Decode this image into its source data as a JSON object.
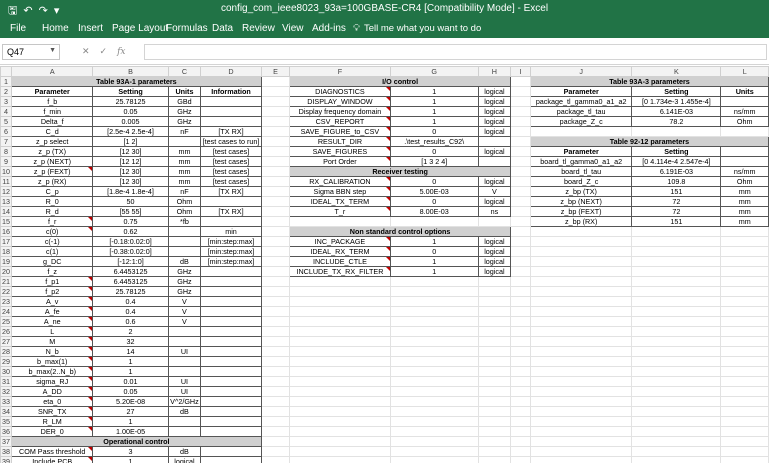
{
  "window": {
    "title": "config_com_ieee8023_93a=100GBASE-CR4  [Compatibility Mode] - Excel",
    "qat_icons": [
      "save-icon",
      "undo-icon",
      "redo-icon",
      "customize-icon"
    ]
  },
  "ribbon": {
    "tabs": [
      "File",
      "Home",
      "Insert",
      "Page Layout",
      "Formulas",
      "Data",
      "Review",
      "View",
      "Add-ins"
    ],
    "tell_me": "Tell me what you want to do"
  },
  "formula_bar": {
    "name_box": "Q47",
    "fx_label": "fx",
    "value": ""
  },
  "accent_color": "#217346",
  "columns": [
    "A",
    "B",
    "C",
    "D",
    "E",
    "F",
    "G",
    "H",
    "I",
    "J",
    "K",
    "L"
  ],
  "rows": [
    [
      "Table 93A-1 parameters",
      "",
      "",
      "",
      "",
      "I/O control",
      "",
      "",
      "",
      "Table 93A-3 parameters",
      "",
      ""
    ],
    [
      "Parameter",
      "Setting",
      "Units",
      "Information",
      "",
      "DIAGNOSTICS",
      "1",
      "logical",
      "",
      "Parameter",
      "Setting",
      "Units"
    ],
    [
      "f_b",
      "25.78125",
      "GBd",
      "",
      "",
      "DISPLAY_WINDOW",
      "1",
      "logical",
      "",
      "package_tl_gamma0_a1_a2",
      "[0 1.734e-3 1.455e-4]",
      ""
    ],
    [
      "f_min",
      "0.05",
      "GHz",
      "",
      "",
      "Display frequency domain",
      "1",
      "logical",
      "",
      "package_tl_tau",
      "6.141E-03",
      "ns/mm"
    ],
    [
      "Delta_f",
      "0.005",
      "GHz",
      "",
      "",
      "CSV_REPORT",
      "1",
      "logical",
      "",
      "package_Z_c",
      "78.2",
      "Ohm"
    ],
    [
      "C_d",
      "[2.5e-4 2.5e-4]",
      "nF",
      "[TX RX]",
      "",
      "SAVE_FIGURE_to_CSV",
      "0",
      "logical",
      "",
      "",
      "",
      ""
    ],
    [
      "z_p select",
      "[1 2]",
      "",
      "[test cases to run]",
      "",
      "RESULT_DIR",
      ".\\test_results_C92\\",
      "",
      "",
      "Table 92-12 parameters",
      "",
      ""
    ],
    [
      "z_p (TX)",
      "[12 30]",
      "mm",
      "[test cases]",
      "",
      "SAVE_FIGURES",
      "0",
      "logical",
      "",
      "Parameter",
      "Setting",
      ""
    ],
    [
      "z_p (NEXT)",
      "[12 12]",
      "mm",
      "[test cases]",
      "",
      "Port Order",
      "[1 3 2 4]",
      "",
      "",
      "board_tl_gamma0_a1_a2",
      "[0 4.114e-4 2.547e-4]",
      ""
    ],
    [
      "z_p (FEXT)",
      "[12 30]",
      "mm",
      "[test cases]",
      "",
      "Receiver testing",
      "",
      "",
      "",
      "board_tl_tau",
      "6.191E-03",
      "ns/mm"
    ],
    [
      "z_p (RX)",
      "[12 30]",
      "mm",
      "[test cases]",
      "",
      "RX_CALIBRATION",
      "0",
      "logical",
      "",
      "board_Z_c",
      "109.8",
      "Ohm"
    ],
    [
      "C_p",
      "[1.8e-4 1.8e-4]",
      "nF",
      "[TX RX]",
      "",
      "Sigma BBN step",
      "5.00E-03",
      "V",
      "",
      "z_bp (TX)",
      "151",
      "mm"
    ],
    [
      "R_0",
      "50",
      "Ohm",
      "",
      "",
      "IDEAL_TX_TERM",
      "0",
      "logical",
      "",
      "z_bp (NEXT)",
      "72",
      "mm"
    ],
    [
      "R_d",
      "[55 55]",
      "Ohm",
      "[TX RX]",
      "",
      "T_r",
      "8.00E-03",
      "ns",
      "",
      "z_bp (FEXT)",
      "72",
      "mm"
    ],
    [
      "f_r",
      "0.75",
      "*fb",
      "",
      "",
      "",
      "",
      "",
      "",
      "z_bp (RX)",
      "151",
      "mm"
    ],
    [
      "c(0)",
      "0.62",
      "",
      "min",
      "",
      "Non standard control options",
      "",
      "",
      "",
      "",
      "",
      ""
    ],
    [
      "c(-1)",
      "[-0.18:0.02:0]",
      "",
      "[min:step:max]",
      "",
      "INC_PACKAGE",
      "1",
      "logical",
      "",
      "",
      "",
      ""
    ],
    [
      "c(1)",
      "[-0.38:0.02:0]",
      "",
      "[min:step:max]",
      "",
      "IDEAL_RX_TERM",
      "0",
      "logical",
      "",
      "",
      "",
      ""
    ],
    [
      "g_DC",
      "[-12:1:0]",
      "dB",
      "[min:step:max]",
      "",
      "INCLUDE_CTLE",
      "1",
      "logical",
      "",
      "",
      "",
      ""
    ],
    [
      "f_z",
      "6.4453125",
      "GHz",
      "",
      "",
      "INCLUDE_TX_RX_FILTER",
      "1",
      "logical",
      "",
      "",
      "",
      ""
    ],
    [
      "f_p1",
      "6.4453125",
      "GHz",
      "",
      "",
      "",
      "",
      "",
      "",
      "",
      "",
      ""
    ],
    [
      "f_p2",
      "25.78125",
      "GHz",
      "",
      "",
      "",
      "",
      "",
      "",
      "",
      "",
      ""
    ],
    [
      "A_v",
      "0.4",
      "V",
      "",
      "",
      "",
      "",
      "",
      "",
      "",
      "",
      ""
    ],
    [
      "A_fe",
      "0.4",
      "V",
      "",
      "",
      "",
      "",
      "",
      "",
      "",
      "",
      ""
    ],
    [
      "A_ne",
      "0.6",
      "V",
      "",
      "",
      "",
      "",
      "",
      "",
      "",
      "",
      ""
    ],
    [
      "L",
      "2",
      "",
      "",
      "",
      "",
      "",
      "",
      "",
      "",
      "",
      ""
    ],
    [
      "M",
      "32",
      "",
      "",
      "",
      "",
      "",
      "",
      "",
      "",
      "",
      ""
    ],
    [
      "N_b",
      "14",
      "UI",
      "",
      "",
      "",
      "",
      "",
      "",
      "",
      "",
      ""
    ],
    [
      "b_max(1)",
      "1",
      "",
      "",
      "",
      "",
      "",
      "",
      "",
      "",
      "",
      ""
    ],
    [
      "b_max(2..N_b)",
      "1",
      "",
      "",
      "",
      "",
      "",
      "",
      "",
      "",
      "",
      ""
    ],
    [
      "sigma_RJ",
      "0.01",
      "UI",
      "",
      "",
      "",
      "",
      "",
      "",
      "",
      "",
      ""
    ],
    [
      "A_DD",
      "0.05",
      "UI",
      "",
      "",
      "",
      "",
      "",
      "",
      "",
      "",
      ""
    ],
    [
      "eta_0",
      "5.20E-08",
      "V^2/GHz",
      "",
      "",
      "",
      "",
      "",
      "",
      "",
      "",
      ""
    ],
    [
      "SNR_TX",
      "27",
      "dB",
      "",
      "",
      "",
      "",
      "",
      "",
      "",
      "",
      ""
    ],
    [
      "R_LM",
      "1",
      "",
      "",
      "",
      "",
      "",
      "",
      "",
      "",
      "",
      ""
    ],
    [
      "DER_0",
      "1.00E-05",
      "",
      "",
      "",
      "",
      "",
      "",
      "",
      "",
      "",
      ""
    ],
    [
      "Operational control",
      "",
      "",
      "",
      "",
      "",
      "",
      "",
      "",
      "",
      "",
      ""
    ],
    [
      "COM Pass threshold",
      "3",
      "dB",
      "",
      "",
      "",
      "",
      "",
      "",
      "",
      "",
      ""
    ],
    [
      "Include PCB",
      "1",
      "logical",
      "",
      "",
      "",
      "",
      "",
      "",
      "",
      "",
      ""
    ]
  ]
}
